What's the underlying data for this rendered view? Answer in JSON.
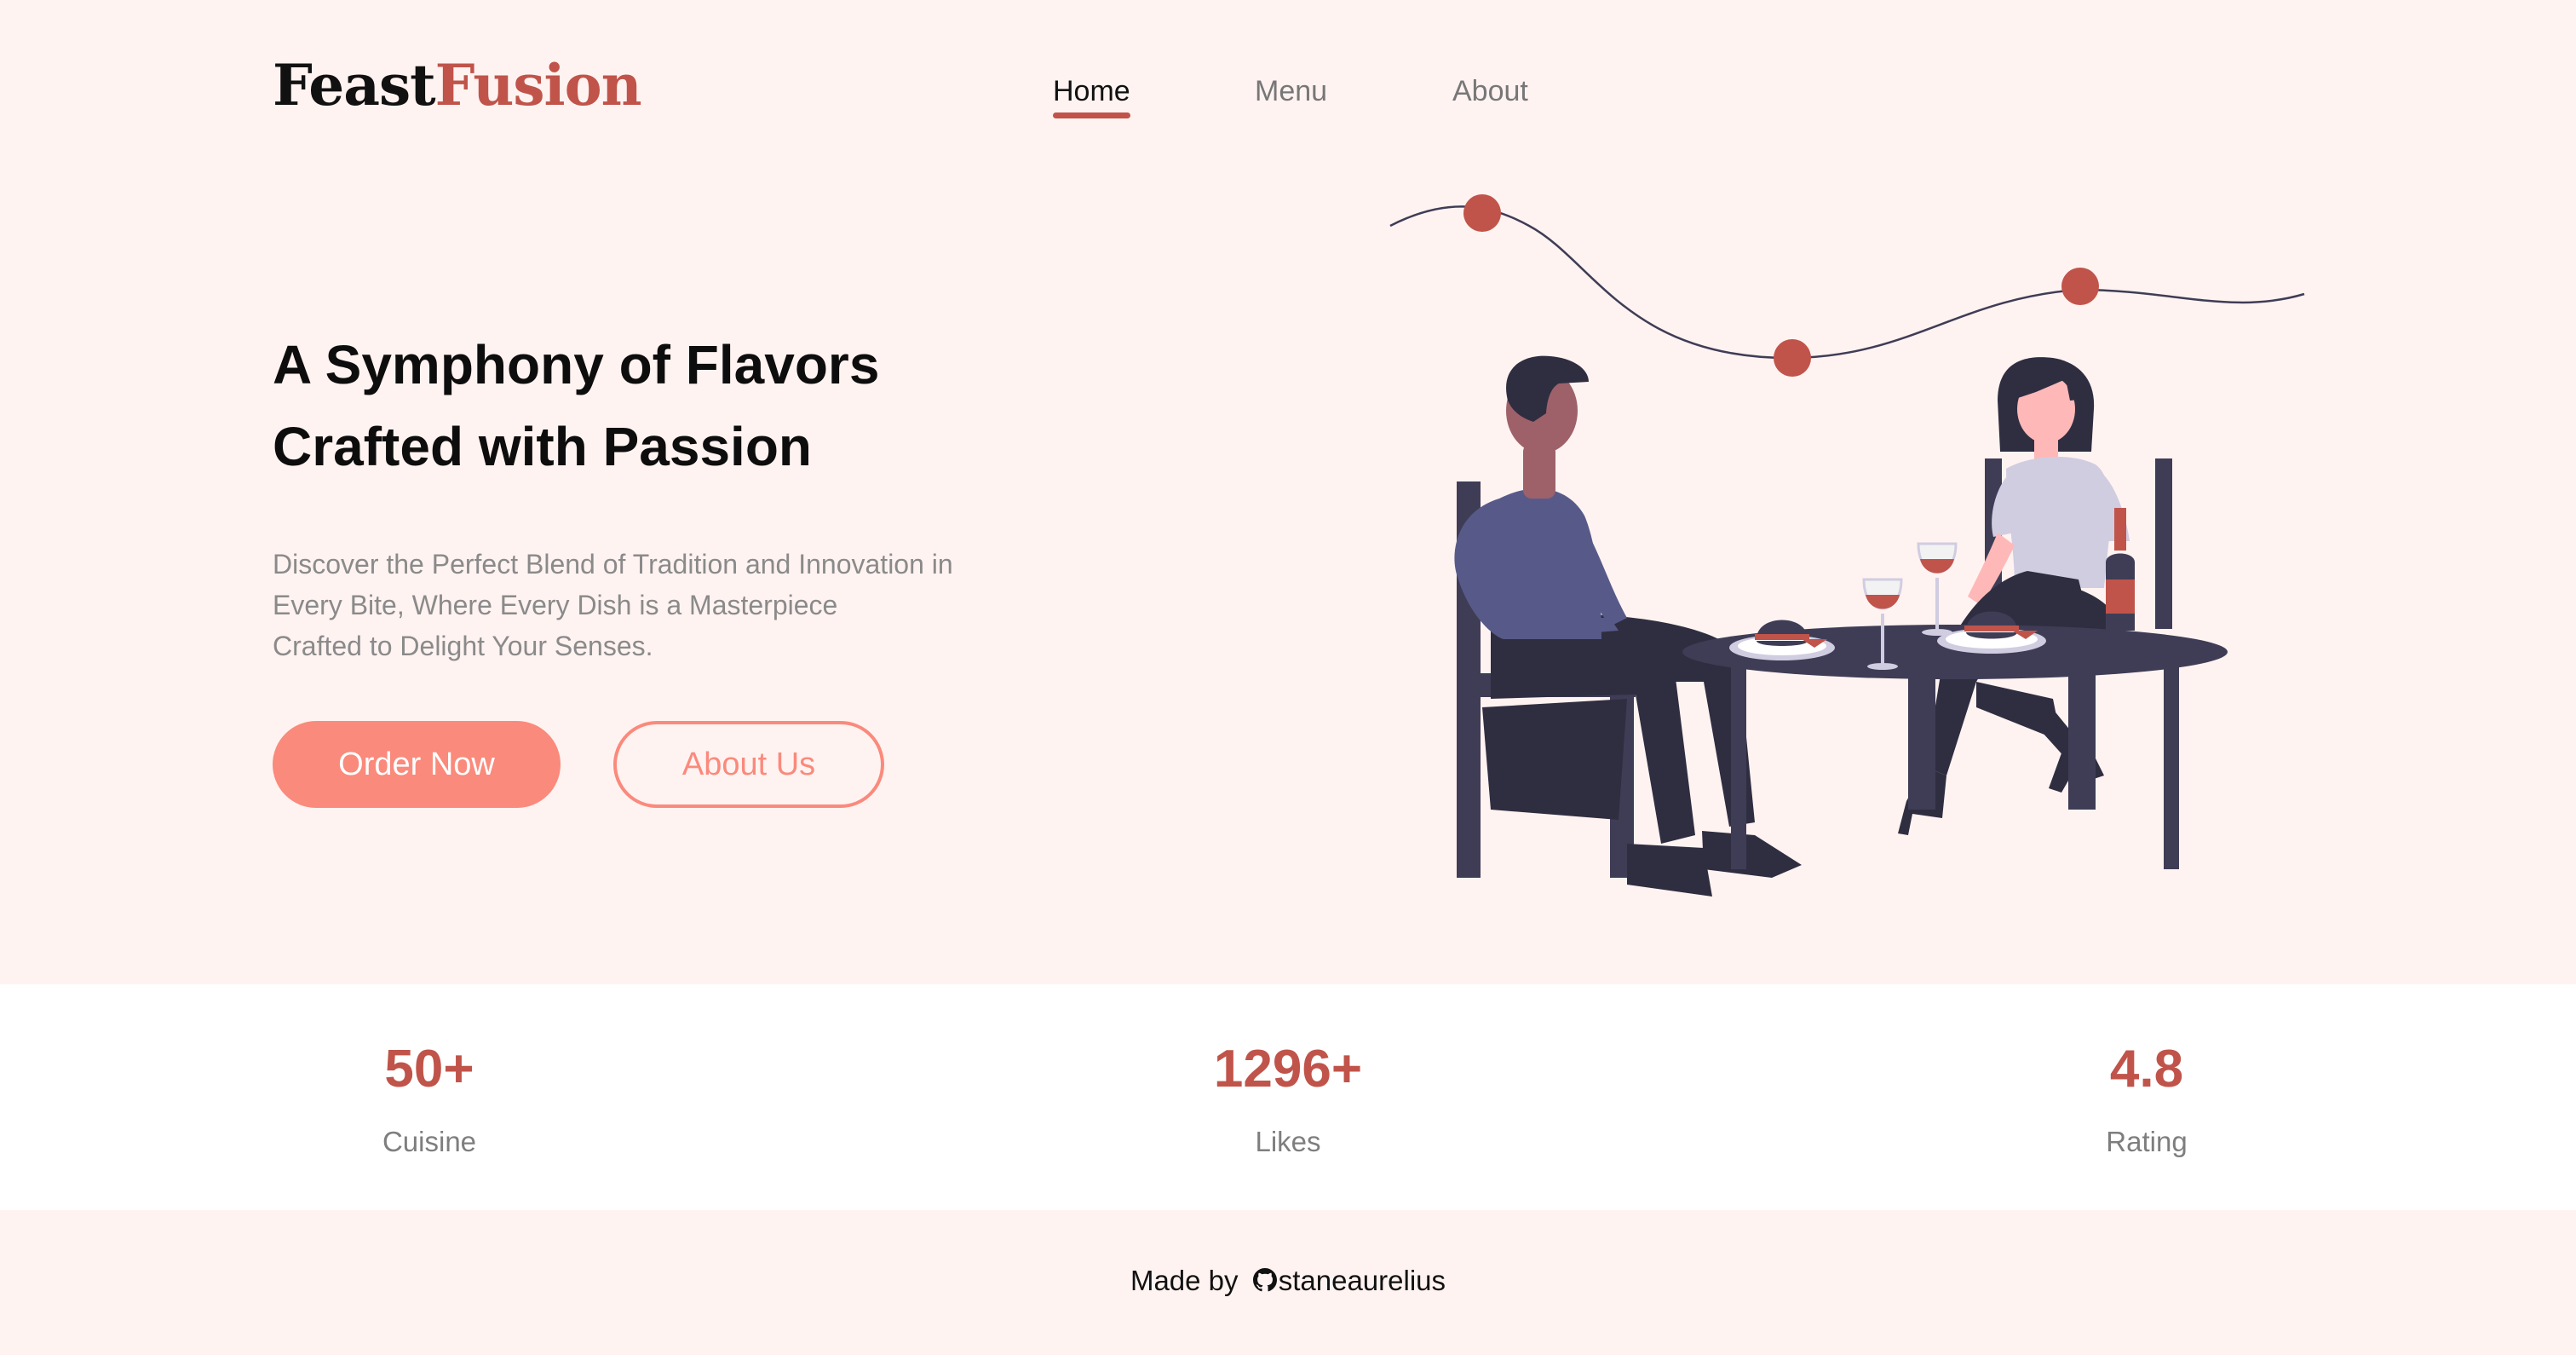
{
  "logo": {
    "part1": "Feast",
    "part2": "Fusion"
  },
  "nav": {
    "items": [
      "Home",
      "Menu",
      "About"
    ],
    "active": "Home"
  },
  "hero": {
    "title_line1": "A Symphony of Flavors",
    "title_line2": "Crafted with Passion",
    "desc_line1": "Discover the Perfect Blend of Tradition and Innovation in",
    "desc_line2": "Every Bite, Where Every Dish is a Masterpiece",
    "desc_line3": "Crafted to Delight Your Senses.",
    "primary_button": "Order Now",
    "secondary_button": "About Us"
  },
  "stats": [
    {
      "value": "50+",
      "label": "Cuisine"
    },
    {
      "value": "1296+",
      "label": "Likes"
    },
    {
      "value": "4.8",
      "label": "Rating"
    }
  ],
  "footer": {
    "prefix": "Made by",
    "author": "staneaurelius",
    "icon": "github-icon"
  },
  "colors": {
    "accent": "#c0544a",
    "button": "#fa8a7c",
    "background": "#fff3f1",
    "shirt_man": "#575a89",
    "dark": "#2f2e41",
    "shirt_woman": "#d0cde1",
    "skin": "#ffb8b8"
  }
}
